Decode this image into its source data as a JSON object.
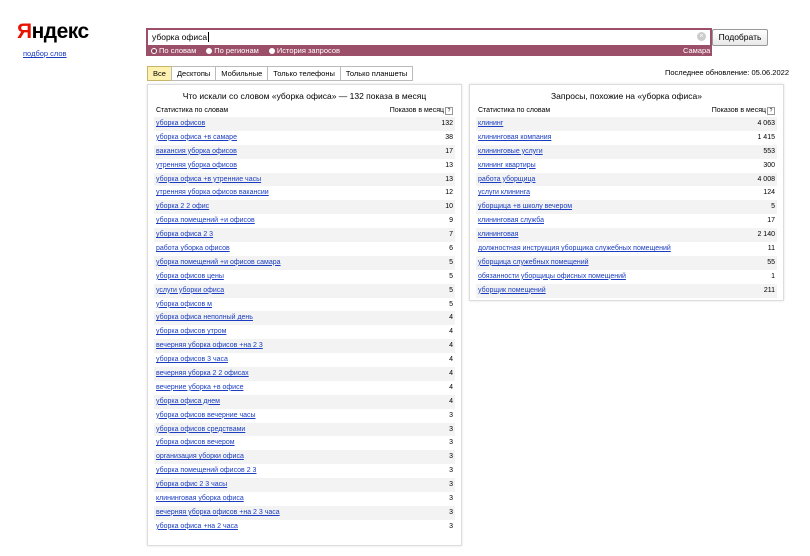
{
  "logo": {
    "ya": "Я",
    "rest": "ндекс",
    "sub": "подбор слов"
  },
  "search": {
    "value": "уборка офиса",
    "button": "Подобрать",
    "clear_icon": "close-icon",
    "modes": [
      "По словам",
      "По регионам",
      "История запросов"
    ],
    "region": "Самара"
  },
  "tabs": [
    "Все",
    "Десктопы",
    "Мобильные",
    "Только телефоны",
    "Только планшеты"
  ],
  "updated": "Последнее обновление: 05.06.2022",
  "left": {
    "title": "Что искали со словом «уборка офиса» — 132 показа в месяц",
    "col1": "Статистика по словам",
    "col2": "Показов в месяц",
    "rows": [
      [
        "уборка офисов",
        "132"
      ],
      [
        "уборка офиса +в самаре",
        "38"
      ],
      [
        "вакансия уборка офисов",
        "17"
      ],
      [
        "утренняя уборка офисов",
        "13"
      ],
      [
        "уборка офиса +в утренние часы",
        "13"
      ],
      [
        "утренняя уборка офисов вакансии",
        "12"
      ],
      [
        "уборка 2 2 офис",
        "10"
      ],
      [
        "уборка помещений +и офисов",
        "9"
      ],
      [
        "уборка офиса 2 3",
        "7"
      ],
      [
        "работа уборка офисов",
        "6"
      ],
      [
        "уборка помещений +и офисов самара",
        "5"
      ],
      [
        "уборка офисов цены",
        "5"
      ],
      [
        "услуги уборки офиса",
        "5"
      ],
      [
        "уборка офисов м",
        "5"
      ],
      [
        "уборка офиса неполный день",
        "4"
      ],
      [
        "уборка офисов утром",
        "4"
      ],
      [
        "вечерняя уборка офисов +на 2 3",
        "4"
      ],
      [
        "уборка офисов 3 часа",
        "4"
      ],
      [
        "вечерняя уборка 2 2 офисах",
        "4"
      ],
      [
        "вечерние уборка +в офисе",
        "4"
      ],
      [
        "уборка офиса днем",
        "4"
      ],
      [
        "уборка офисов вечерние часы",
        "3"
      ],
      [
        "уборка офисов средствами",
        "3"
      ],
      [
        "уборка офисов вечером",
        "3"
      ],
      [
        "организация уборки офиса",
        "3"
      ],
      [
        "уборка помещений офисов 2 3",
        "3"
      ],
      [
        "уборка офис 2 3 часы",
        "3"
      ],
      [
        "клининговая уборка офиса",
        "3"
      ],
      [
        "вечерняя уборка офисов +на 2 3 часа",
        "3"
      ],
      [
        "уборка офиса +на 2 часа",
        "3"
      ]
    ]
  },
  "right": {
    "title": "Запросы, похожие на «уборка офиса»",
    "col1": "Статистика по словам",
    "col2": "Показов в месяц",
    "rows": [
      [
        "клининг",
        "4 063"
      ],
      [
        "клининговая компания",
        "1 415"
      ],
      [
        "клининговые услуги",
        "553"
      ],
      [
        "клининг квартиры",
        "300"
      ],
      [
        "работа уборщица",
        "4 008"
      ],
      [
        "услуги клининга",
        "124"
      ],
      [
        "уборщица +в школу вечером",
        "5"
      ],
      [
        "клининговая служба",
        "17"
      ],
      [
        "клининговая",
        "2 140"
      ],
      [
        "должностная инструкция уборщика служебных помещений",
        "11"
      ],
      [
        "уборщица служебных помещений",
        "55"
      ],
      [
        "обязанности уборщицы офисных помещений",
        "1"
      ],
      [
        "уборщик помещений",
        "211"
      ]
    ]
  }
}
